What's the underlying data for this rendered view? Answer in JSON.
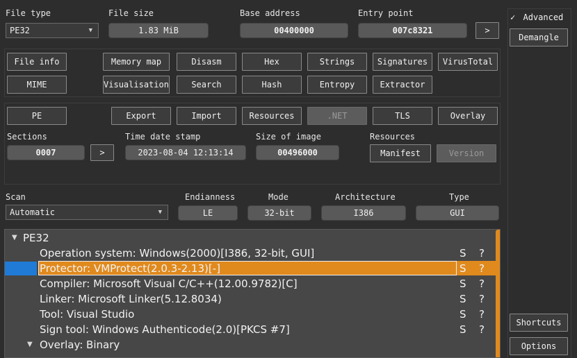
{
  "header": {
    "file_type_label": "File type",
    "file_type_value": "PE32",
    "file_size_label": "File size",
    "file_size_value": "1.83 MiB",
    "base_address_label": "Base address",
    "base_address_value": "00400000",
    "entry_point_label": "Entry point",
    "entry_point_value": "007c8321",
    "entry_go": ">"
  },
  "tools_row1": [
    "File info",
    "Memory map",
    "Disasm",
    "Hex",
    "Strings",
    "Signatures",
    "VirusTotal"
  ],
  "tools_row2": [
    "MIME",
    "Visualisation",
    "Search",
    "Hash",
    "Entropy",
    "Extractor"
  ],
  "pe_row": [
    "PE",
    "Export",
    "Import",
    "Resources",
    ".NET",
    "TLS",
    "Overlay"
  ],
  "pe_info": {
    "sections_label": "Sections",
    "sections_value": "0007",
    "sections_go": ">",
    "timestamp_label": "Time date stamp",
    "timestamp_value": "2023-08-04 12:13:14",
    "image_size_label": "Size of image",
    "image_size_value": "00496000",
    "resources_label": "Resources",
    "manifest_btn": "Manifest",
    "version_btn": "Version"
  },
  "scan": {
    "scan_label": "Scan",
    "scan_value": "Automatic",
    "endianness_label": "Endianness",
    "endianness_value": "LE",
    "mode_label": "Mode",
    "mode_value": "32-bit",
    "arch_label": "Architecture",
    "arch_value": "I386",
    "type_label": "Type",
    "type_value": "GUI"
  },
  "results": {
    "root": "PE32",
    "items": [
      {
        "text": "Operation system: Windows(2000)[I386, 32-bit, GUI]",
        "s": "S",
        "q": "?"
      },
      {
        "text": "Protector: VMProtect(2.0.3-2.13)[-]",
        "s": "S",
        "q": "?"
      },
      {
        "text": "Compiler: Microsoft Visual C/C++(12.00.9782)[C]",
        "s": "S",
        "q": "?"
      },
      {
        "text": "Linker: Microsoft Linker(5.12.8034)",
        "s": "S",
        "q": "?"
      },
      {
        "text": "Tool: Visual Studio",
        "s": "S",
        "q": "?"
      },
      {
        "text": "Sign tool: Windows Authenticode(2.0)[PKCS #7]",
        "s": "S",
        "q": "?"
      }
    ],
    "overlay": "Overlay: Binary",
    "selected_index": 1
  },
  "side": {
    "advanced_check": "✓",
    "advanced_label": "Advanced",
    "demangle": "Demangle",
    "shortcuts": "Shortcuts",
    "options": "Options"
  },
  "colors": {
    "accent": "#e08a1e",
    "selection_marker": "#1f7bd6",
    "background": "#2d2d2d"
  }
}
